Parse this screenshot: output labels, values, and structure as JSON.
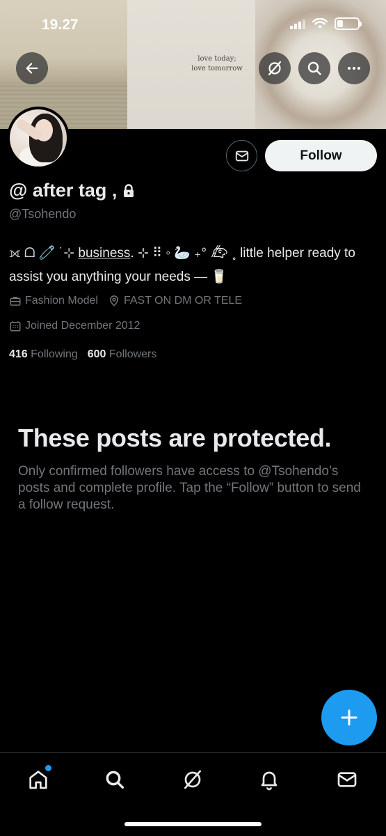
{
  "status_bar": {
    "time": "19.27"
  },
  "banner": {
    "quote_line1": "love today;",
    "quote_line2": "love tomorrow"
  },
  "header": {
    "follow_label": "Follow"
  },
  "profile": {
    "display_name": "@ after tag ,",
    "handle": "@Tsohendo",
    "bio_prefix": "⟗ ᗝ 🧷 ˙⊹ ",
    "bio_link": "business",
    "bio_middle": ".  ⊹  ⠿ ◦ 🦢 ₊° 𐃶 ˳ little helper ready to assist you anything your needs ⎯⎯ 🥛",
    "profession": "Fashion Model",
    "location": "FAST ON DM OR TELE",
    "joined": "Joined December 2012",
    "following_count": "416",
    "following_label": "Following",
    "followers_count": "600",
    "followers_label": "Followers"
  },
  "protected": {
    "title": "These posts are protected.",
    "body": "Only confirmed followers have access to @Tsohendo’s posts and complete profile. Tap the “Follow” button to send a follow request."
  },
  "colors": {
    "accent": "#1d9bf0",
    "background": "#000000",
    "muted_text": "#71767b",
    "primary_text": "#e7e9ea"
  },
  "icons": [
    "back-arrow-icon",
    "grok-icon",
    "search-icon",
    "more-icon",
    "mail-icon",
    "lock-icon",
    "briefcase-icon",
    "location-pin-icon",
    "calendar-icon",
    "compose-plus-icon",
    "home-icon",
    "bell-icon"
  ]
}
